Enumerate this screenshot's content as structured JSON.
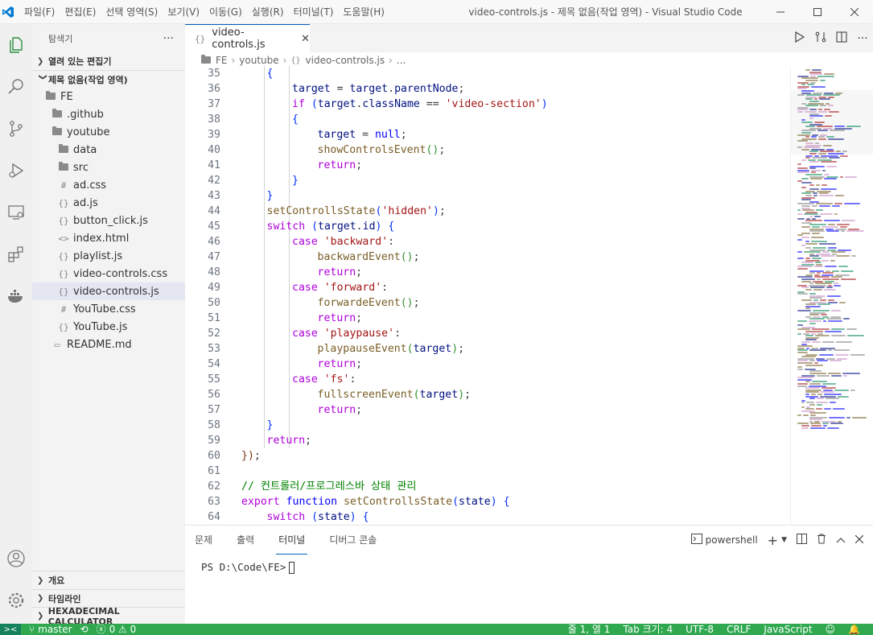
{
  "window": {
    "title": "video-controls.js - 제목 없음(작업 영역) - Visual Studio Code",
    "menu": [
      "파일(F)",
      "편집(E)",
      "선택 영역(S)",
      "보기(V)",
      "이동(G)",
      "실행(R)",
      "터미널(T)",
      "도움말(H)"
    ]
  },
  "sidebar": {
    "title": "탐색기",
    "more": "···",
    "open_editors": "열려 있는 편집기",
    "workspace": "제목 없음(작업 영역)",
    "tree": [
      {
        "label": "FE",
        "type": "folder-open",
        "indent": 0
      },
      {
        "label": ".github",
        "type": "folder",
        "indent": 1
      },
      {
        "label": "youtube",
        "type": "folder-open",
        "indent": 1
      },
      {
        "label": "data",
        "type": "folder",
        "indent": 2
      },
      {
        "label": "src",
        "type": "folder",
        "indent": 2
      },
      {
        "label": "ad.css",
        "type": "css",
        "indent": 2
      },
      {
        "label": "ad.js",
        "type": "js",
        "indent": 2
      },
      {
        "label": "button_click.js",
        "type": "js",
        "indent": 2
      },
      {
        "label": "index.html",
        "type": "html",
        "indent": 2
      },
      {
        "label": "playlist.js",
        "type": "js",
        "indent": 2
      },
      {
        "label": "video-controls.css",
        "type": "js",
        "indent": 2
      },
      {
        "label": "video-controls.js",
        "type": "js",
        "indent": 2,
        "active": true
      },
      {
        "label": "YouTube.css",
        "type": "css",
        "indent": 2
      },
      {
        "label": "YouTube.js",
        "type": "js",
        "indent": 2
      },
      {
        "label": "README.md",
        "type": "md",
        "indent": 1
      }
    ],
    "bottom_sections": [
      "개요",
      "타임라인",
      "HEXADECIMAL CALCULATOR"
    ]
  },
  "tab": {
    "icon": "{}",
    "label": "video-controls.js",
    "close": "✕"
  },
  "breadcrumb": [
    "FE",
    "youtube",
    "video-controls.js",
    "..."
  ],
  "code": {
    "lines": [
      {
        "n": "35",
        "indent": 1,
        "tokens": [
          [
            "{",
            "br1"
          ]
        ]
      },
      {
        "n": "36",
        "indent": 2,
        "tokens": [
          [
            "target",
            "var"
          ],
          [
            " = ",
            ""
          ],
          [
            "target",
            "var"
          ],
          [
            ".",
            ""
          ],
          [
            "parentNode",
            "var"
          ],
          [
            ";",
            ""
          ]
        ]
      },
      {
        "n": "37",
        "indent": 2,
        "tokens": [
          [
            "if",
            "kw"
          ],
          [
            " (",
            "br1"
          ],
          [
            "target",
            "var"
          ],
          [
            ".",
            ""
          ],
          [
            "className",
            "var"
          ],
          [
            " == ",
            ""
          ],
          [
            "'video-section'",
            "str"
          ],
          [
            ")",
            "br1"
          ]
        ]
      },
      {
        "n": "38",
        "indent": 2,
        "tokens": [
          [
            "{",
            "br1"
          ]
        ]
      },
      {
        "n": "39",
        "indent": 3,
        "tokens": [
          [
            "target",
            "var"
          ],
          [
            " = ",
            ""
          ],
          [
            "null",
            "kw2"
          ],
          [
            ";",
            ""
          ]
        ]
      },
      {
        "n": "40",
        "indent": 3,
        "tokens": [
          [
            "showControlsEvent",
            "fn"
          ],
          [
            "()",
            "br2"
          ],
          [
            ";",
            ""
          ]
        ]
      },
      {
        "n": "41",
        "indent": 3,
        "tokens": [
          [
            "return",
            "kw"
          ],
          [
            ";",
            ""
          ]
        ]
      },
      {
        "n": "42",
        "indent": 2,
        "tokens": [
          [
            "}",
            "br1"
          ]
        ]
      },
      {
        "n": "43",
        "indent": 1,
        "tokens": [
          [
            "}",
            "br1"
          ]
        ]
      },
      {
        "n": "44",
        "indent": 1,
        "tokens": [
          [
            "setControllsState",
            "fn"
          ],
          [
            "(",
            "br1"
          ],
          [
            "'hidden'",
            "str"
          ],
          [
            ")",
            "br1"
          ],
          [
            ";",
            ""
          ]
        ]
      },
      {
        "n": "45",
        "indent": 1,
        "tokens": [
          [
            "switch",
            "kw"
          ],
          [
            " (",
            "br1"
          ],
          [
            "target",
            "var"
          ],
          [
            ".",
            ""
          ],
          [
            "id",
            "var"
          ],
          [
            ") {",
            "br1"
          ]
        ]
      },
      {
        "n": "46",
        "indent": 2,
        "tokens": [
          [
            "case",
            "kw"
          ],
          [
            " ",
            ""
          ],
          [
            "'backward'",
            "str"
          ],
          [
            ":",
            ""
          ]
        ]
      },
      {
        "n": "47",
        "indent": 3,
        "tokens": [
          [
            "backwardEvent",
            "fn"
          ],
          [
            "()",
            "br2"
          ],
          [
            ";",
            ""
          ]
        ]
      },
      {
        "n": "48",
        "indent": 3,
        "tokens": [
          [
            "return",
            "kw"
          ],
          [
            ";",
            ""
          ]
        ]
      },
      {
        "n": "49",
        "indent": 2,
        "tokens": [
          [
            "case",
            "kw"
          ],
          [
            " ",
            ""
          ],
          [
            "'forward'",
            "str"
          ],
          [
            ":",
            ""
          ]
        ]
      },
      {
        "n": "50",
        "indent": 3,
        "tokens": [
          [
            "forwardeEvent",
            "fn"
          ],
          [
            "()",
            "br2"
          ],
          [
            ";",
            ""
          ]
        ]
      },
      {
        "n": "51",
        "indent": 3,
        "tokens": [
          [
            "return",
            "kw"
          ],
          [
            ";",
            ""
          ]
        ]
      },
      {
        "n": "52",
        "indent": 2,
        "tokens": [
          [
            "case",
            "kw"
          ],
          [
            " ",
            ""
          ],
          [
            "'playpause'",
            "str"
          ],
          [
            ":",
            ""
          ]
        ]
      },
      {
        "n": "53",
        "indent": 3,
        "tokens": [
          [
            "playpauseEvent",
            "fn"
          ],
          [
            "(",
            "br2"
          ],
          [
            "target",
            "var"
          ],
          [
            ")",
            "br2"
          ],
          [
            ";",
            ""
          ]
        ]
      },
      {
        "n": "54",
        "indent": 3,
        "tokens": [
          [
            "return",
            "kw"
          ],
          [
            ";",
            ""
          ]
        ]
      },
      {
        "n": "55",
        "indent": 2,
        "tokens": [
          [
            "case",
            "kw"
          ],
          [
            " ",
            ""
          ],
          [
            "'fs'",
            "str"
          ],
          [
            ":",
            ""
          ]
        ]
      },
      {
        "n": "56",
        "indent": 3,
        "tokens": [
          [
            "fullscreenEvent",
            "fn"
          ],
          [
            "(",
            "br2"
          ],
          [
            "target",
            "var"
          ],
          [
            ")",
            "br2"
          ],
          [
            ";",
            ""
          ]
        ]
      },
      {
        "n": "57",
        "indent": 3,
        "tokens": [
          [
            "return",
            "kw"
          ],
          [
            ";",
            ""
          ]
        ]
      },
      {
        "n": "58",
        "indent": 1,
        "tokens": [
          [
            "}",
            "br1"
          ]
        ]
      },
      {
        "n": "59",
        "indent": 1,
        "tokens": [
          [
            "return",
            "kw"
          ],
          [
            ";",
            ""
          ]
        ]
      },
      {
        "n": "60",
        "indent": 0,
        "tokens": [
          [
            "})",
            "br3"
          ],
          [
            ";",
            ""
          ]
        ]
      },
      {
        "n": "61",
        "indent": 0,
        "tokens": []
      },
      {
        "n": "62",
        "indent": 0,
        "tokens": [
          [
            "// 컨트롤러/프로그레스바 상태 관리",
            "cm"
          ]
        ]
      },
      {
        "n": "63",
        "indent": 0,
        "tokens": [
          [
            "export",
            "kw"
          ],
          [
            " ",
            ""
          ],
          [
            "function",
            "kw2"
          ],
          [
            " ",
            ""
          ],
          [
            "setControllsState",
            "fn"
          ],
          [
            "(",
            "br1"
          ],
          [
            "state",
            "var"
          ],
          [
            ") {",
            "br1"
          ]
        ]
      },
      {
        "n": "64",
        "indent": 1,
        "tokens": [
          [
            "switch",
            "kw"
          ],
          [
            " (",
            "br1"
          ],
          [
            "state",
            "var"
          ],
          [
            ") {",
            "br1"
          ]
        ]
      }
    ]
  },
  "panel": {
    "tabs": [
      "문제",
      "출력",
      "터미널",
      "디버그 콘솔"
    ],
    "active_tab": "터미널",
    "shell": "powershell",
    "prompt": "PS D:\\Code\\FE>"
  },
  "status": {
    "branch": "master",
    "problems": "0 ⚠ 0",
    "position": "줄 1, 열 1",
    "tab_size": "Tab 크기: 4",
    "encoding": "UTF-8",
    "eol": "CRLF",
    "language": "JavaScript"
  },
  "colors": {
    "accent": "#005fb8",
    "statusbar": "#2fa84f"
  }
}
